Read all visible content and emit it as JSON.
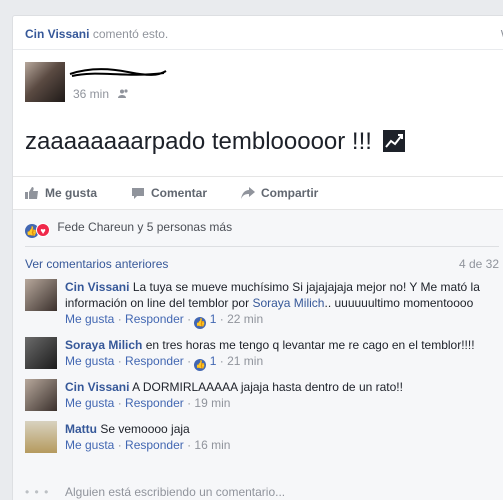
{
  "story": {
    "actor": "Cin Vissani",
    "action": "comentó esto.",
    "menu": "∨"
  },
  "post": {
    "time": "36 min",
    "audience_icon": "friends-icon",
    "text": "zaaaaaaaarpado temblooooor !!!",
    "emoji_icon": "chart-increasing-icon"
  },
  "actions": {
    "like": "Me gusta",
    "comment": "Comentar",
    "share": "Compartir"
  },
  "reactions": {
    "text": "Fede Chareun y 5 personas más"
  },
  "comments_section": {
    "view_previous": "Ver comentarios anteriores",
    "count": "4 de 32",
    "typing": "Alguien está escribiendo un comentario...",
    "typing_dots": "• • •"
  },
  "comments": [
    {
      "name": "Cin Vissani",
      "text_a": "La tuya se mueve muchísimo Si jajajajaja mejor no! Y Me mató la información on line del temblor por",
      "mention": "Soraya Milich",
      "text_b": ".. uuuuuultimo momentoooo",
      "like": "Me gusta",
      "reply": "Responder",
      "likes": "1",
      "time": "22 min"
    },
    {
      "name": "Soraya Milich",
      "text_a": "en tres horas me tengo q levantar me re cago en el temblor!!!!",
      "like": "Me gusta",
      "reply": "Responder",
      "likes": "1",
      "time": "21 min"
    },
    {
      "name": "Cin Vissani",
      "text_a": "A DORMIRLAAAAA jajaja hasta dentro de un rato!!",
      "like": "Me gusta",
      "reply": "Responder",
      "time": "19 min"
    },
    {
      "name": "Mattu",
      "text_a": "Se vemoooo jaja",
      "like": "Me gusta",
      "reply": "Responder",
      "time": "16 min"
    }
  ],
  "colors": {
    "link": "#365899",
    "accent": "#4267b2",
    "love": "#f0284a",
    "muted": "#90949c"
  }
}
